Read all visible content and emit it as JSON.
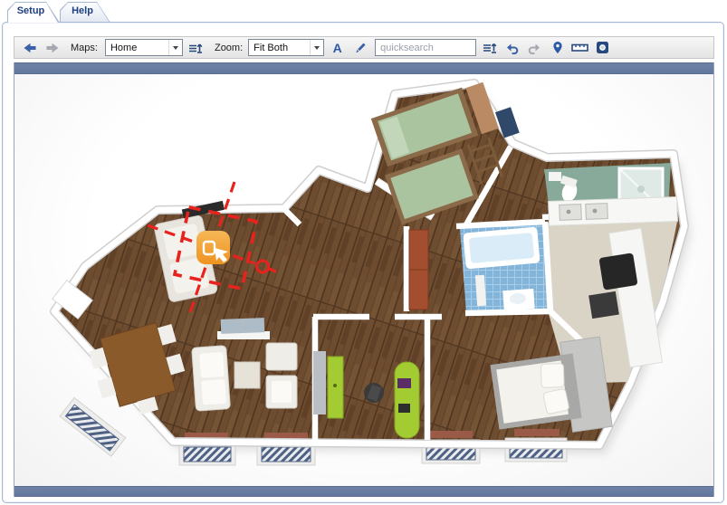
{
  "tabs": [
    {
      "label": "Setup",
      "active": true
    },
    {
      "label": "Help",
      "active": false
    }
  ],
  "toolbar": {
    "back_icon": "back-arrow",
    "forward_icon": "forward-arrow",
    "maps_label": "Maps:",
    "maps_value": "Home",
    "maps_list_icon": "map-list",
    "zoom_label": "Zoom:",
    "zoom_value": "Fit Both",
    "font_button_label": "A",
    "draw_icon": "pen",
    "search_placeholder": "quicksearch",
    "icons_right": [
      "item-list",
      "undo",
      "redo",
      "location-pin",
      "ruler",
      "snapshot"
    ]
  },
  "map": {
    "view": "3d-floorplan-home",
    "selection": {
      "marker": "device-marker",
      "marker_shape": "orange-rounded-square",
      "overlay": "red-dashed-crosshair-with-selection-box-and-circle-handle"
    }
  },
  "palette": {
    "accent-bar": "#6e81a6",
    "tab-text": "#1e3f7f",
    "icon-blue": "#3b62a8",
    "icon-gray": "#a4a9b0",
    "icon-navy": "#27497e",
    "crosshair": "#e8231d",
    "marker-orange": "#f2a33c",
    "floor-wood": "#6d4c2f",
    "bath-teal": "#87aa9b",
    "bath-blue": "#83b4da",
    "kitchen-floor": "#dad4c6",
    "furniture-lime": "#a3cc33",
    "wardrobe-red": "#a34f2f",
    "bed-green": "#a9c49f"
  }
}
